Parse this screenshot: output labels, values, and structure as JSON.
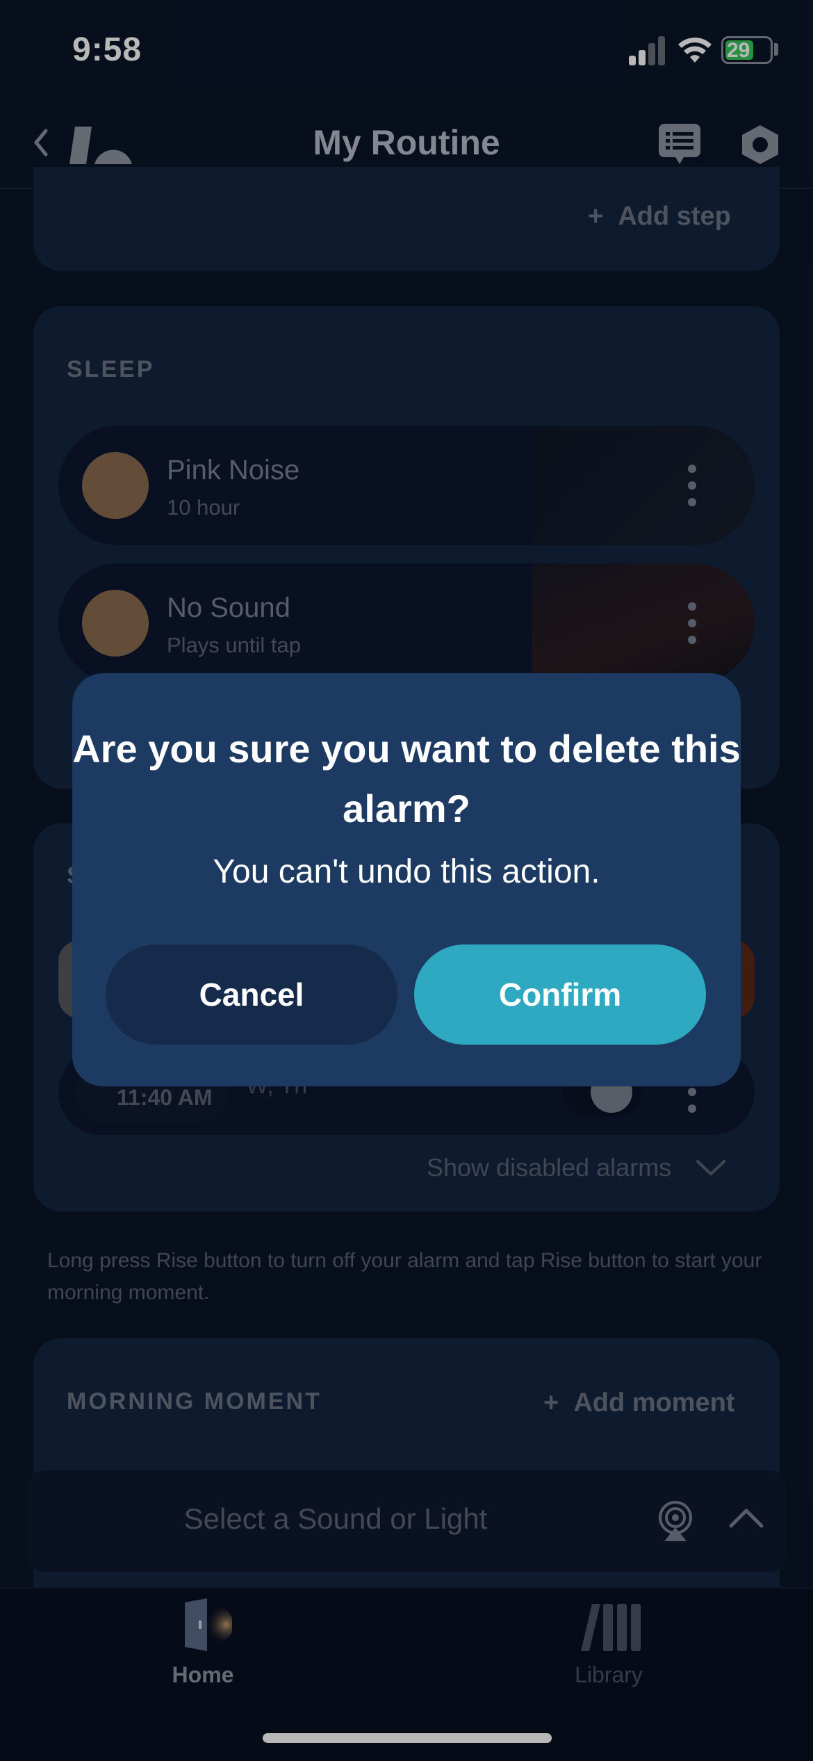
{
  "status_bar": {
    "time": "9:58",
    "battery": "29"
  },
  "header": {
    "title": "My Routine"
  },
  "routine": {
    "add_step": "Add step",
    "sleep": {
      "label": "SLEEP",
      "items": [
        {
          "title": "Pink Noise",
          "subtitle": "10 hour"
        },
        {
          "title": "No Sound",
          "subtitle": "Plays until tap"
        }
      ]
    },
    "alarms": {
      "label_partial": "S",
      "alarm_time": "11:40 AM",
      "alarm_days": "W, Th",
      "show_disabled": "Show disabled alarms"
    },
    "helper_text": "Long press Rise button to turn off your alarm and tap Rise button to start your morning moment.",
    "morning": {
      "label": "MORNING MOMENT",
      "add_moment": "Add moment"
    }
  },
  "mini_player": {
    "text": "Select a Sound or Light"
  },
  "tab_bar": {
    "home": "Home",
    "library": "Library"
  },
  "dialog": {
    "title": "Are you sure you want to delete this alarm?",
    "subtitle": "You can't undo this action.",
    "cancel": "Cancel",
    "confirm": "Confirm"
  },
  "colors": {
    "background": "#0b1529",
    "dialog": "#1c3a62",
    "confirm": "#2fa9c2",
    "cancel": "#162b4c",
    "battery_green": "#35c759"
  }
}
